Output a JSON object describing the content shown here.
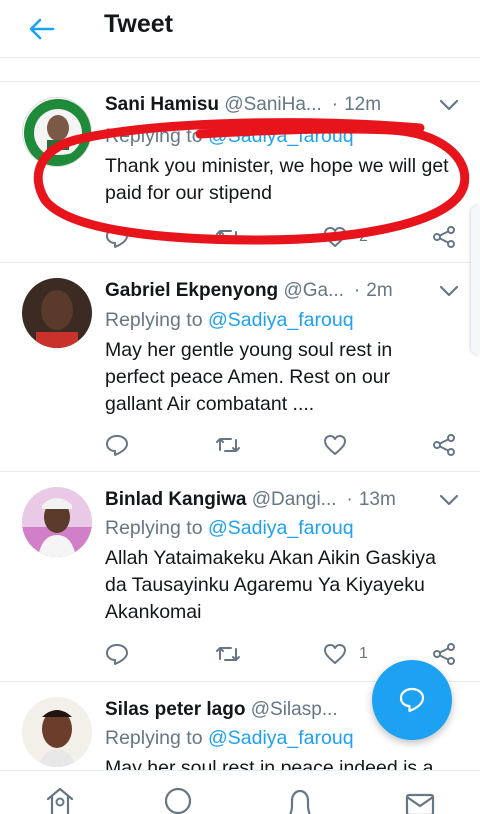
{
  "header": {
    "title": "Tweet",
    "back_icon": "arrow-left-icon",
    "accent": "#1da1f2"
  },
  "tweets": [
    {
      "name": "Sani Hamisu",
      "handle": "@SaniHa...",
      "time": "12m",
      "reply_prefix": "Replying to",
      "mention": "@Sadiya_farouq",
      "text": "Thank you minister, we hope we will get paid for our stipend",
      "likes": "2",
      "retweets": ""
    },
    {
      "name": "Gabriel Ekpenyong",
      "handle": "@Ga...",
      "time": "2m",
      "reply_prefix": "Replying to",
      "mention": "@Sadiya_farouq",
      "text": "May her gentle young soul rest in perfect peace Amen. Rest on our gallant Air combatant ....",
      "likes": "",
      "retweets": ""
    },
    {
      "name": "Binlad Kangiwa",
      "handle": "@Dangi...",
      "time": "13m",
      "reply_prefix": "Replying to",
      "mention": "@Sadiya_farouq",
      "text": "Allah Yataimakeku Akan Aikin Gaskiya da Tausayinku Agaremu Ya Kiyayeku Akankomai",
      "likes": "1",
      "retweets": ""
    },
    {
      "name": "Silas peter lago",
      "handle": "@Silasp...",
      "time": "",
      "reply_prefix": "Replying to",
      "mention": "@Sadiya_farouq",
      "text": "May her soul rest in peace indeed is a",
      "likes": "",
      "retweets": ""
    }
  ],
  "nav": {
    "items": [
      "home-icon",
      "search-icon",
      "notifications-icon",
      "messages-icon"
    ]
  },
  "fab": {
    "icon": "compose-reply-icon",
    "color": "#1da1f2"
  },
  "annotation": {
    "color": "#e8141c"
  }
}
